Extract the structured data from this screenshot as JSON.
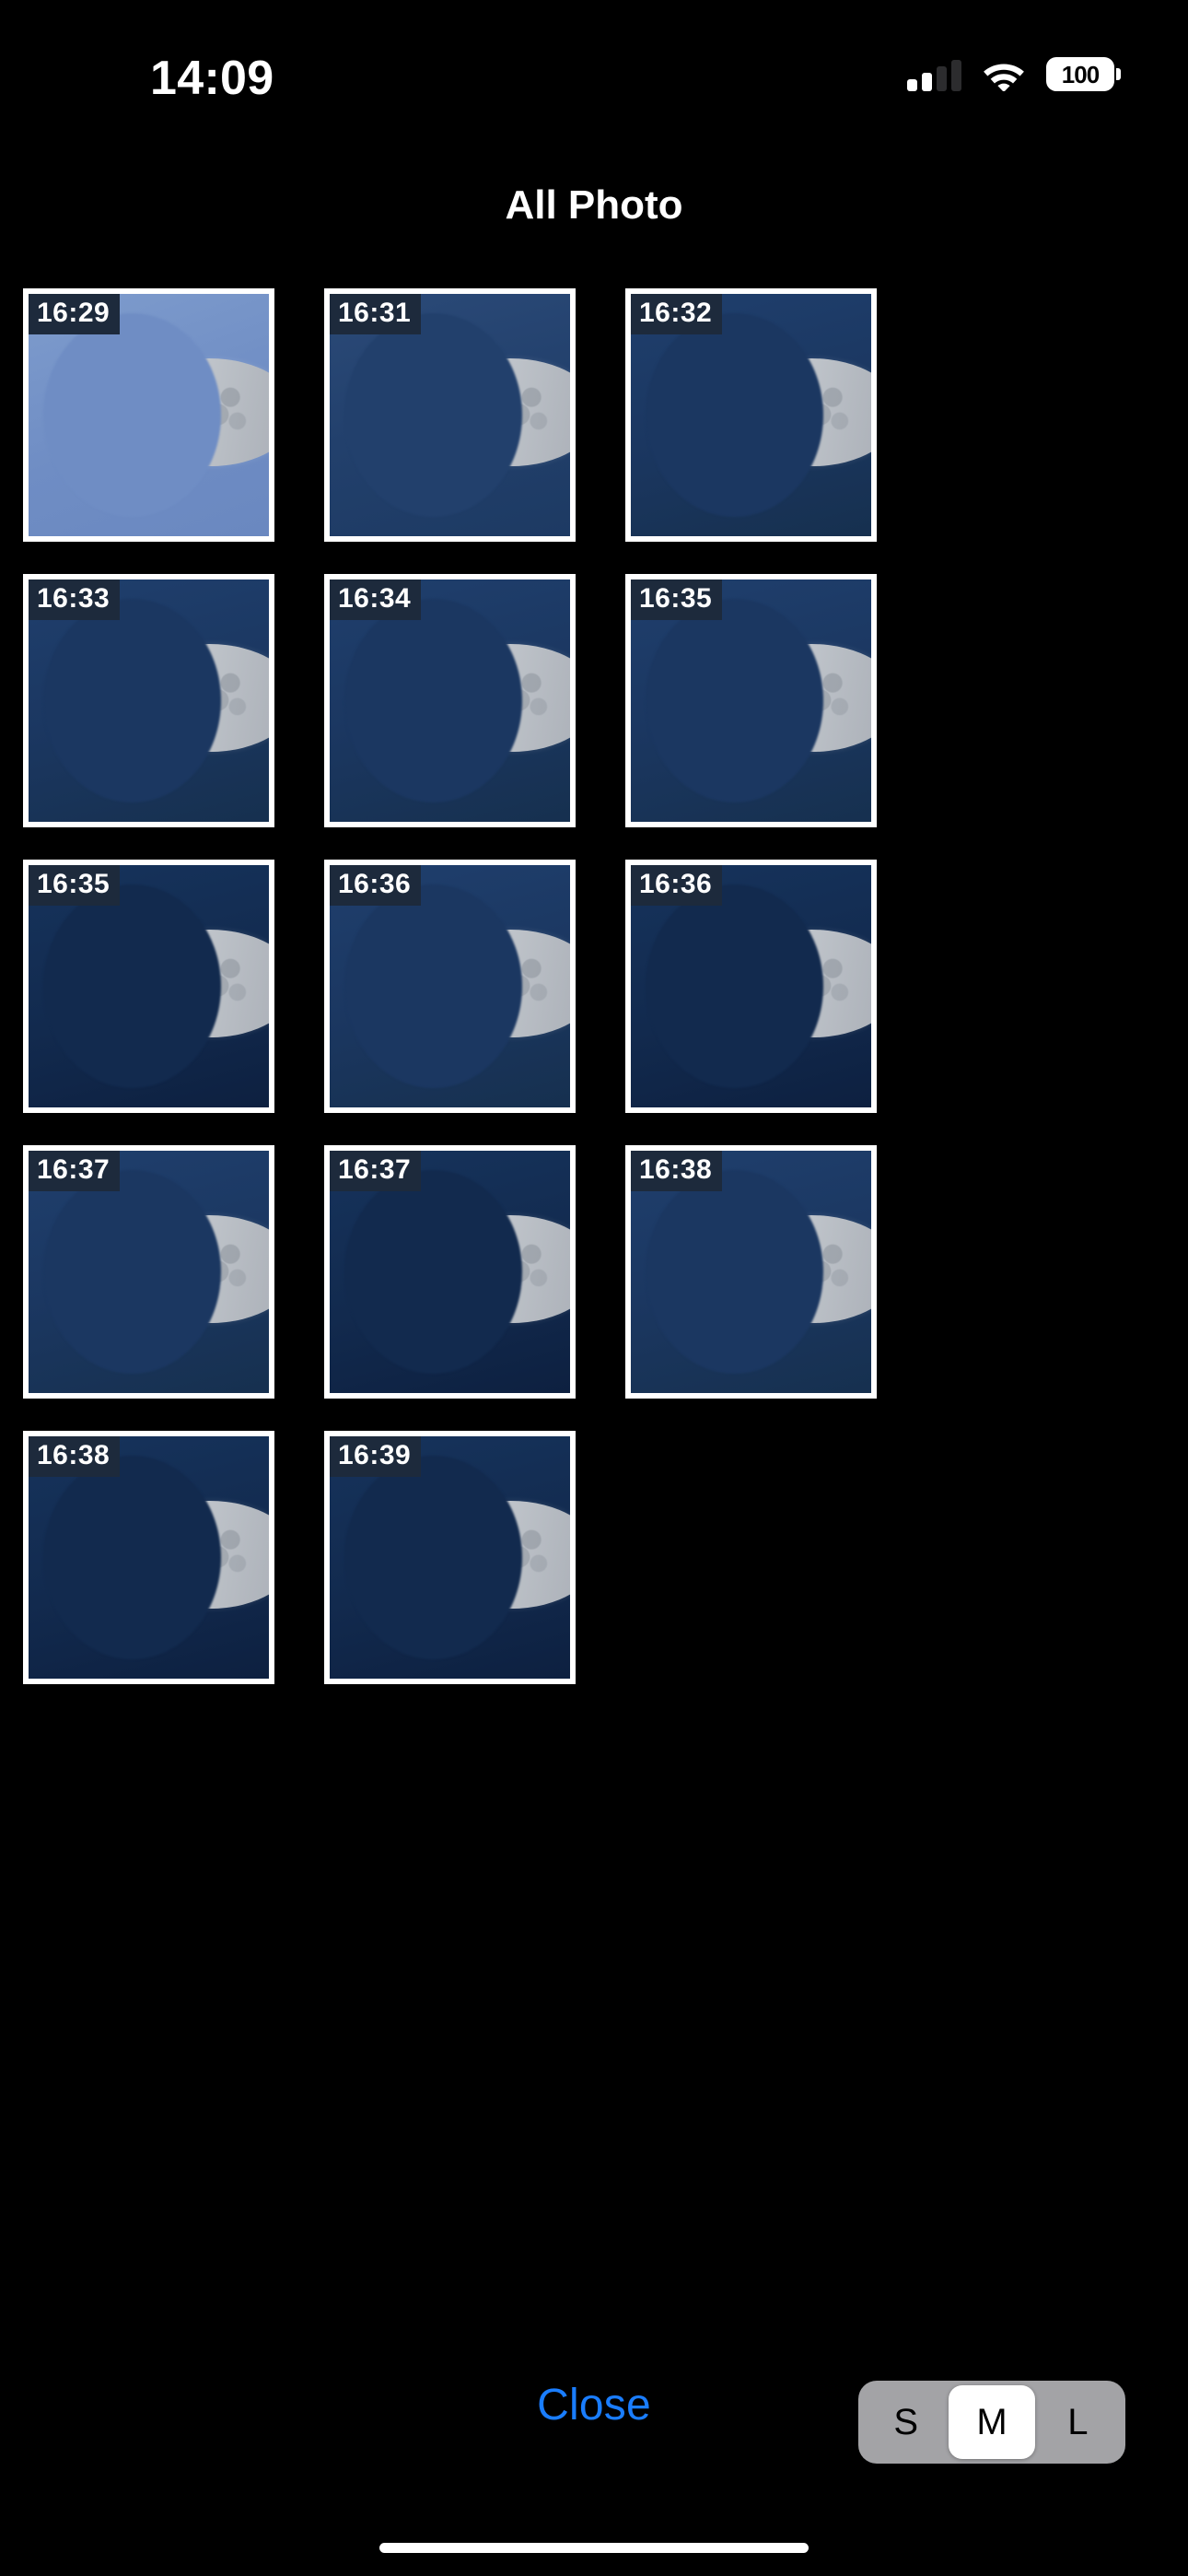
{
  "statusbar": {
    "time": "14:09",
    "battery_percent": "100",
    "cellular_icon": "cellular-bars-icon",
    "wifi_icon": "wifi-icon",
    "battery_icon": "battery-icon"
  },
  "header": {
    "title": "All Photo"
  },
  "gallery": {
    "columns": 4,
    "photos": [
      {
        "time": "16:29",
        "sky": "sky-light"
      },
      {
        "time": "16:31",
        "sky": "sky-mid"
      },
      {
        "time": "16:32",
        "sky": "sky-dark"
      },
      {
        "time": "16:33",
        "sky": "sky-dark"
      },
      {
        "time": "16:34",
        "sky": "sky-dark"
      },
      {
        "time": "16:35",
        "sky": "sky-dark"
      },
      {
        "time": "16:35",
        "sky": "sky-night"
      },
      {
        "time": "16:36",
        "sky": "sky-dark"
      },
      {
        "time": "16:36",
        "sky": "sky-night"
      },
      {
        "time": "16:37",
        "sky": "sky-dark"
      },
      {
        "time": "16:37",
        "sky": "sky-night"
      },
      {
        "time": "16:38",
        "sky": "sky-dark"
      },
      {
        "time": "16:38",
        "sky": "sky-night"
      },
      {
        "time": "16:39",
        "sky": "sky-night"
      }
    ]
  },
  "footer": {
    "close_label": "Close",
    "size_options": [
      {
        "label": "S",
        "selected": false
      },
      {
        "label": "M",
        "selected": true
      },
      {
        "label": "L",
        "selected": false
      }
    ]
  },
  "colors": {
    "background": "#000000",
    "accent_blue": "#1a7dff",
    "segment_track": "#a3a3a6",
    "segment_thumb": "#ffffff",
    "timestamp_chip": "#1d2a3c",
    "photo_border": "#ffffff"
  }
}
